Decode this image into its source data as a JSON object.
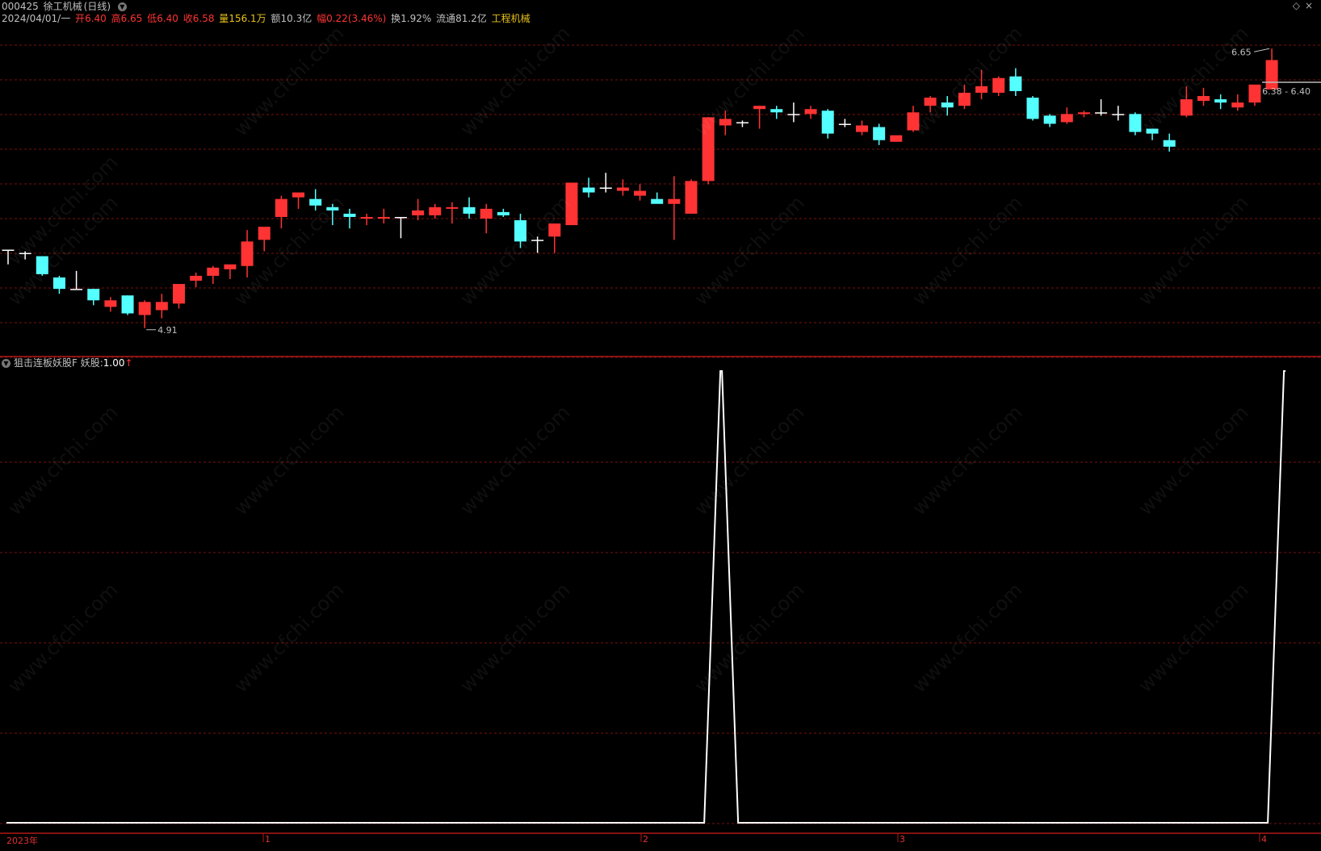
{
  "header": {
    "code": "000425",
    "name": "徐工机械",
    "period": "(日线)",
    "date": "2024/04/01/一",
    "open_label": "开",
    "open": "6.40",
    "high_label": "高",
    "high": "6.65",
    "low_label": "低",
    "low": "6.40",
    "close_label": "收",
    "close": "6.58",
    "vol_label": "量",
    "vol": "156.1万",
    "amt_label": "额",
    "amt": "10.3亿",
    "chg_label": "幅",
    "chg": "0.22(3.46%)",
    "turn_label": "换",
    "turn": "1.92%",
    "float_label": "流通",
    "float": "81.2亿",
    "sector": "工程机械"
  },
  "top_icons": [
    "diamond-icon",
    "close-icon"
  ],
  "price_annotations": {
    "high_mark": "6.65",
    "low_mark": "4.91",
    "range_mark": "6.38 - 6.40"
  },
  "indicator": {
    "name": "狙击连板妖股F",
    "label": "妖股:",
    "value": "1.00",
    "arrow": "↑"
  },
  "x_axis": {
    "labels": [
      "2023年",
      "1",
      "2",
      "3",
      "4"
    ]
  },
  "watermark": "www.cfchi.com",
  "colors": {
    "up": "#ff3333",
    "down": "#54ffff",
    "flat": "#ffffff",
    "grid": "#7a1010",
    "divider": "#b01818",
    "indicator_line": "#ffffff"
  },
  "chart_data": {
    "type": "candlestick",
    "ylim": [
      4.85,
      6.75
    ],
    "candles": [
      {
        "o": 5.42,
        "h": 5.42,
        "l": 5.33,
        "c": 5.42
      },
      {
        "o": 5.4,
        "h": 5.41,
        "l": 5.36,
        "c": 5.4
      },
      {
        "o": 5.38,
        "h": 5.38,
        "l": 5.26,
        "c": 5.27
      },
      {
        "o": 5.25,
        "h": 5.26,
        "l": 5.15,
        "c": 5.18
      },
      {
        "o": 5.18,
        "h": 5.29,
        "l": 5.18,
        "c": 5.18
      },
      {
        "o": 5.18,
        "h": 5.18,
        "l": 5.08,
        "c": 5.11
      },
      {
        "o": 5.07,
        "h": 5.13,
        "l": 5.04,
        "c": 5.11
      },
      {
        "o": 5.14,
        "h": 5.14,
        "l": 5.02,
        "c": 5.03
      },
      {
        "o": 5.02,
        "h": 5.11,
        "l": 4.94,
        "c": 5.1
      },
      {
        "o": 5.05,
        "h": 5.15,
        "l": 5.0,
        "c": 5.1
      },
      {
        "o": 5.09,
        "h": 5.21,
        "l": 5.06,
        "c": 5.21
      },
      {
        "o": 5.23,
        "h": 5.28,
        "l": 5.19,
        "c": 5.26
      },
      {
        "o": 5.26,
        "h": 5.32,
        "l": 5.21,
        "c": 5.31
      },
      {
        "o": 5.3,
        "h": 5.32,
        "l": 5.24,
        "c": 5.33
      },
      {
        "o": 5.32,
        "h": 5.54,
        "l": 5.25,
        "c": 5.47
      },
      {
        "o": 5.48,
        "h": 5.55,
        "l": 5.41,
        "c": 5.56
      },
      {
        "o": 5.62,
        "h": 5.75,
        "l": 5.55,
        "c": 5.73
      },
      {
        "o": 5.74,
        "h": 5.76,
        "l": 5.67,
        "c": 5.77
      },
      {
        "o": 5.73,
        "h": 5.79,
        "l": 5.66,
        "c": 5.69
      },
      {
        "o": 5.68,
        "h": 5.7,
        "l": 5.57,
        "c": 5.66
      },
      {
        "o": 5.64,
        "h": 5.67,
        "l": 5.55,
        "c": 5.62
      },
      {
        "o": 5.61,
        "h": 5.64,
        "l": 5.57,
        "c": 5.62
      },
      {
        "o": 5.61,
        "h": 5.67,
        "l": 5.58,
        "c": 5.62
      },
      {
        "o": 5.62,
        "h": 5.62,
        "l": 5.49,
        "c": 5.62
      },
      {
        "o": 5.63,
        "h": 5.73,
        "l": 5.6,
        "c": 5.66
      },
      {
        "o": 5.63,
        "h": 5.7,
        "l": 5.61,
        "c": 5.68
      },
      {
        "o": 5.67,
        "h": 5.71,
        "l": 5.58,
        "c": 5.68
      },
      {
        "o": 5.68,
        "h": 5.74,
        "l": 5.61,
        "c": 5.64
      },
      {
        "o": 5.61,
        "h": 5.7,
        "l": 5.52,
        "c": 5.67
      },
      {
        "o": 5.65,
        "h": 5.67,
        "l": 5.62,
        "c": 5.63
      },
      {
        "o": 5.6,
        "h": 5.64,
        "l": 5.43,
        "c": 5.47
      },
      {
        "o": 5.48,
        "h": 5.5,
        "l": 5.4,
        "c": 5.48
      },
      {
        "o": 5.5,
        "h": 5.57,
        "l": 5.4,
        "c": 5.58
      },
      {
        "o": 5.57,
        "h": 5.82,
        "l": 5.57,
        "c": 5.83
      },
      {
        "o": 5.8,
        "h": 5.86,
        "l": 5.74,
        "c": 5.77
      },
      {
        "o": 5.8,
        "h": 5.89,
        "l": 5.77,
        "c": 5.8
      },
      {
        "o": 5.78,
        "h": 5.85,
        "l": 5.75,
        "c": 5.8
      },
      {
        "o": 5.75,
        "h": 5.82,
        "l": 5.72,
        "c": 5.78
      },
      {
        "o": 5.73,
        "h": 5.77,
        "l": 5.71,
        "c": 5.7
      },
      {
        "o": 5.7,
        "h": 5.87,
        "l": 5.48,
        "c": 5.73
      },
      {
        "o": 5.64,
        "h": 5.85,
        "l": 5.64,
        "c": 5.84
      },
      {
        "o": 5.84,
        "h": 6.23,
        "l": 5.82,
        "c": 6.23
      },
      {
        "o": 6.18,
        "h": 6.27,
        "l": 6.12,
        "c": 6.22
      },
      {
        "o": 6.2,
        "h": 6.21,
        "l": 6.17,
        "c": 6.2
      },
      {
        "o": 6.28,
        "h": 6.3,
        "l": 6.16,
        "c": 6.3
      },
      {
        "o": 6.28,
        "h": 6.3,
        "l": 6.22,
        "c": 6.26
      },
      {
        "o": 6.25,
        "h": 6.32,
        "l": 6.2,
        "c": 6.25
      },
      {
        "o": 6.25,
        "h": 6.3,
        "l": 6.22,
        "c": 6.28
      },
      {
        "o": 6.27,
        "h": 6.28,
        "l": 6.1,
        "c": 6.13
      },
      {
        "o": 6.19,
        "h": 6.22,
        "l": 6.17,
        "c": 6.19
      },
      {
        "o": 6.14,
        "h": 6.21,
        "l": 6.12,
        "c": 6.18
      },
      {
        "o": 6.17,
        "h": 6.19,
        "l": 6.06,
        "c": 6.09
      },
      {
        "o": 6.08,
        "h": 6.08,
        "l": 6.08,
        "c": 6.12
      },
      {
        "o": 6.15,
        "h": 6.3,
        "l": 6.14,
        "c": 6.26
      },
      {
        "o": 6.3,
        "h": 6.36,
        "l": 6.26,
        "c": 6.35
      },
      {
        "o": 6.32,
        "h": 6.36,
        "l": 6.24,
        "c": 6.29
      },
      {
        "o": 6.3,
        "h": 6.43,
        "l": 6.28,
        "c": 6.38
      },
      {
        "o": 6.38,
        "h": 6.52,
        "l": 6.34,
        "c": 6.42
      },
      {
        "o": 6.38,
        "h": 6.48,
        "l": 6.36,
        "c": 6.47
      },
      {
        "o": 6.48,
        "h": 6.53,
        "l": 6.36,
        "c": 6.39
      },
      {
        "o": 6.35,
        "h": 6.36,
        "l": 6.21,
        "c": 6.22
      },
      {
        "o": 6.24,
        "h": 6.25,
        "l": 6.17,
        "c": 6.19
      },
      {
        "o": 6.2,
        "h": 6.29,
        "l": 6.19,
        "c": 6.25
      },
      {
        "o": 6.25,
        "h": 6.27,
        "l": 6.23,
        "c": 6.26
      },
      {
        "o": 6.26,
        "h": 6.34,
        "l": 6.24,
        "c": 6.26
      },
      {
        "o": 6.25,
        "h": 6.3,
        "l": 6.21,
        "c": 6.25
      },
      {
        "o": 6.25,
        "h": 6.26,
        "l": 6.12,
        "c": 6.14
      },
      {
        "o": 6.16,
        "h": 6.16,
        "l": 6.09,
        "c": 6.13
      },
      {
        "o": 6.09,
        "h": 6.13,
        "l": 6.02,
        "c": 6.05
      },
      {
        "o": 6.24,
        "h": 6.42,
        "l": 6.23,
        "c": 6.34
      },
      {
        "o": 6.33,
        "h": 6.41,
        "l": 6.3,
        "c": 6.36
      },
      {
        "o": 6.34,
        "h": 6.37,
        "l": 6.28,
        "c": 6.32
      },
      {
        "o": 6.29,
        "h": 6.37,
        "l": 6.27,
        "c": 6.32
      },
      {
        "o": 6.32,
        "h": 6.42,
        "l": 6.3,
        "c": 6.43
      },
      {
        "o": 6.4,
        "h": 6.65,
        "l": 6.4,
        "c": 6.58
      }
    ],
    "indicator_series": {
      "name": "妖股",
      "ylim": [
        0,
        1
      ],
      "spikes_at_candle_index": [
        41,
        74
      ],
      "values_note_omitted": true
    }
  }
}
